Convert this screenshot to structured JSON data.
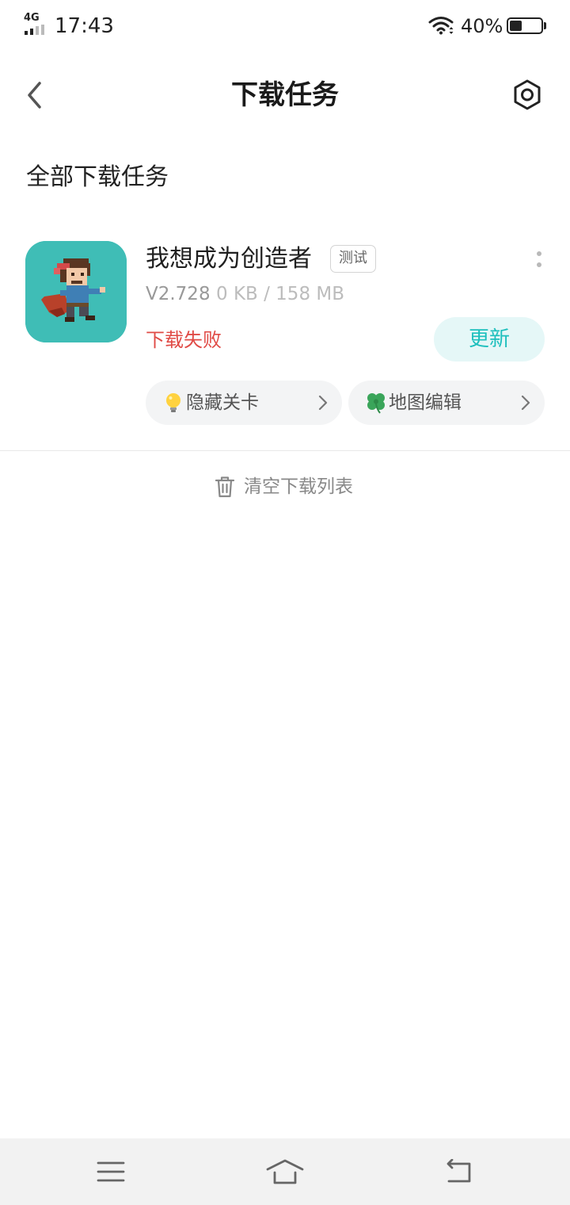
{
  "status_bar": {
    "network": "4G",
    "time": "17:43",
    "battery_text": "40%",
    "battery_level": 0.4
  },
  "header": {
    "title": "下载任务",
    "back_icon": "chevron-left-icon",
    "settings_icon": "hexagon-gear-icon"
  },
  "section_title": "全部下载任务",
  "task": {
    "name": "我想成为创造者",
    "tag": "测试",
    "version": "V2.728",
    "size": "0 KB / 158 MB",
    "status": "下载失败",
    "status_color": "#e04b46",
    "action_label": "更新",
    "accent_color": "#1dbfbd",
    "chips": [
      {
        "label": "隐藏关卡",
        "icon": "lightbulb-emoji"
      },
      {
        "label": "地图编辑",
        "icon": "four-leaf-clover-emoji"
      }
    ]
  },
  "clear_label": "清空下载列表"
}
